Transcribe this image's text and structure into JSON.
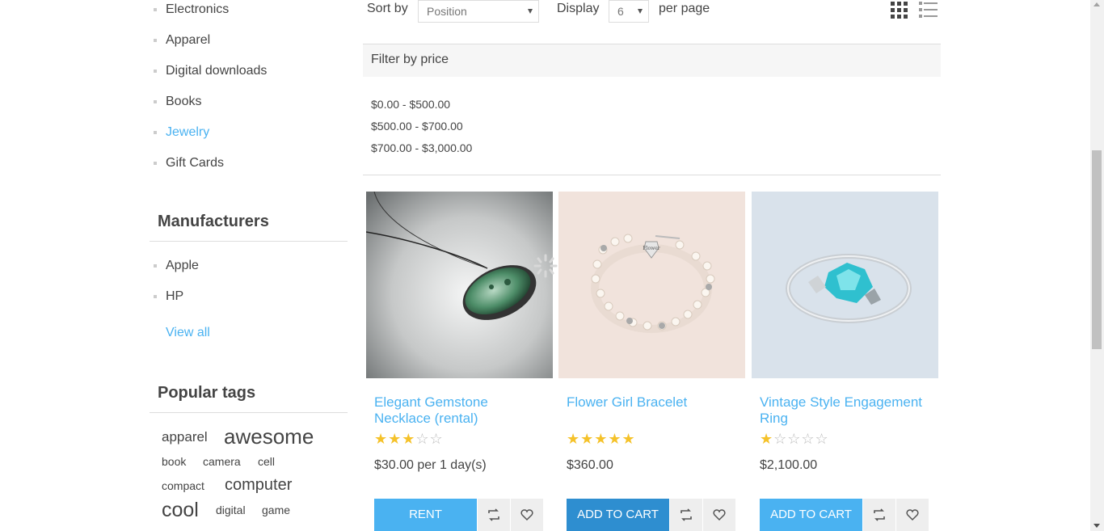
{
  "categories": [
    {
      "label": "Electronics",
      "active": false
    },
    {
      "label": "Apparel",
      "active": false
    },
    {
      "label": "Digital downloads",
      "active": false
    },
    {
      "label": "Books",
      "active": false
    },
    {
      "label": "Jewelry",
      "active": true
    },
    {
      "label": "Gift Cards",
      "active": false
    }
  ],
  "manufacturers": {
    "title": "Manufacturers",
    "items": [
      "Apple",
      "HP"
    ],
    "view_all": "View all"
  },
  "popular_tags": {
    "title": "Popular tags",
    "tags": [
      "apparel",
      "awesome",
      "book",
      "camera",
      "cell",
      "compact",
      "computer",
      "cool",
      "digital",
      "game"
    ]
  },
  "toolbar": {
    "sort_label": "Sort by",
    "sort_value": "Position",
    "display_label": "Display",
    "display_value": "6",
    "per_page_label": "per page",
    "grid_icon": "grid-view-icon",
    "list_icon": "list-view-icon"
  },
  "filter": {
    "title": "Filter by price",
    "ranges": [
      "$0.00 - $500.00",
      "$500.00 - $700.00",
      "$700.00 - $3,000.00"
    ]
  },
  "products": [
    {
      "title": "Elegant Gemstone Necklace (rental)",
      "rating": 3,
      "price": "$30.00 per 1 day(s)",
      "button": "RENT"
    },
    {
      "title": "Flower Girl Bracelet",
      "rating": 5,
      "price": "$360.00",
      "button": "ADD TO CART"
    },
    {
      "title": "Vintage Style Engagement Ring",
      "rating": 1,
      "price": "$2,100.00",
      "button": "ADD TO CART"
    }
  ],
  "colors": {
    "accent": "#4ab2f1",
    "accent_dark": "#2e8ed0",
    "star": "#f5c22a"
  }
}
